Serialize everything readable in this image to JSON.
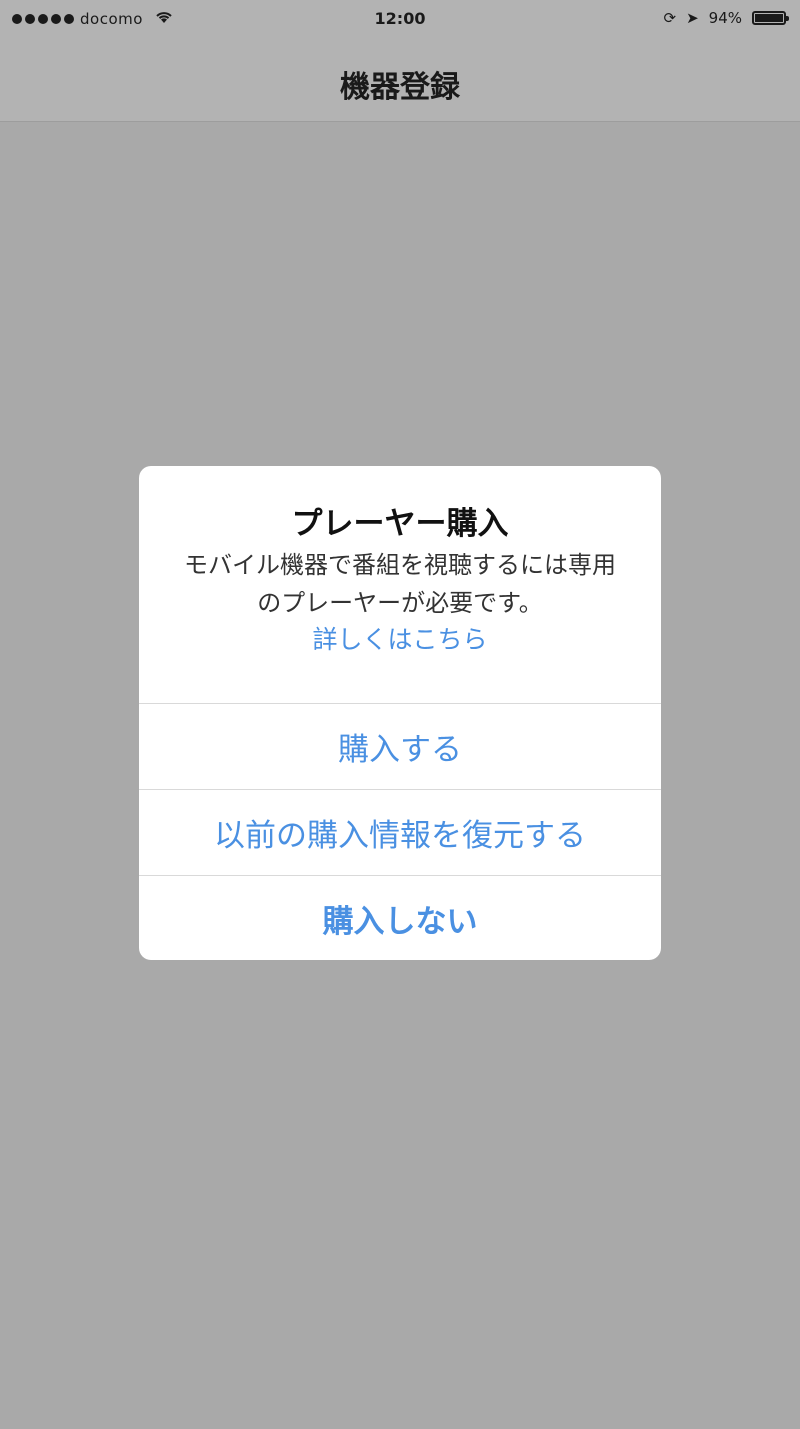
{
  "status_bar": {
    "carrier": "docomo",
    "time": "12:00",
    "battery": "94%",
    "wifi_icon": "wifi-icon",
    "battery_icon": "battery-icon"
  },
  "nav": {
    "title": "機器登録"
  },
  "alert": {
    "title": "プレーヤー購入",
    "message": "モバイル機器で番組を視聴するには専用のプレーヤーが必要です。",
    "link": "詳しくはこちら",
    "buttons": [
      {
        "label": "購入する"
      },
      {
        "label": "以前の購入情報を復元する"
      },
      {
        "label": "購入しない"
      }
    ]
  },
  "colors": {
    "accent": "#4a90e2",
    "overlay": "#a9a9a9"
  }
}
